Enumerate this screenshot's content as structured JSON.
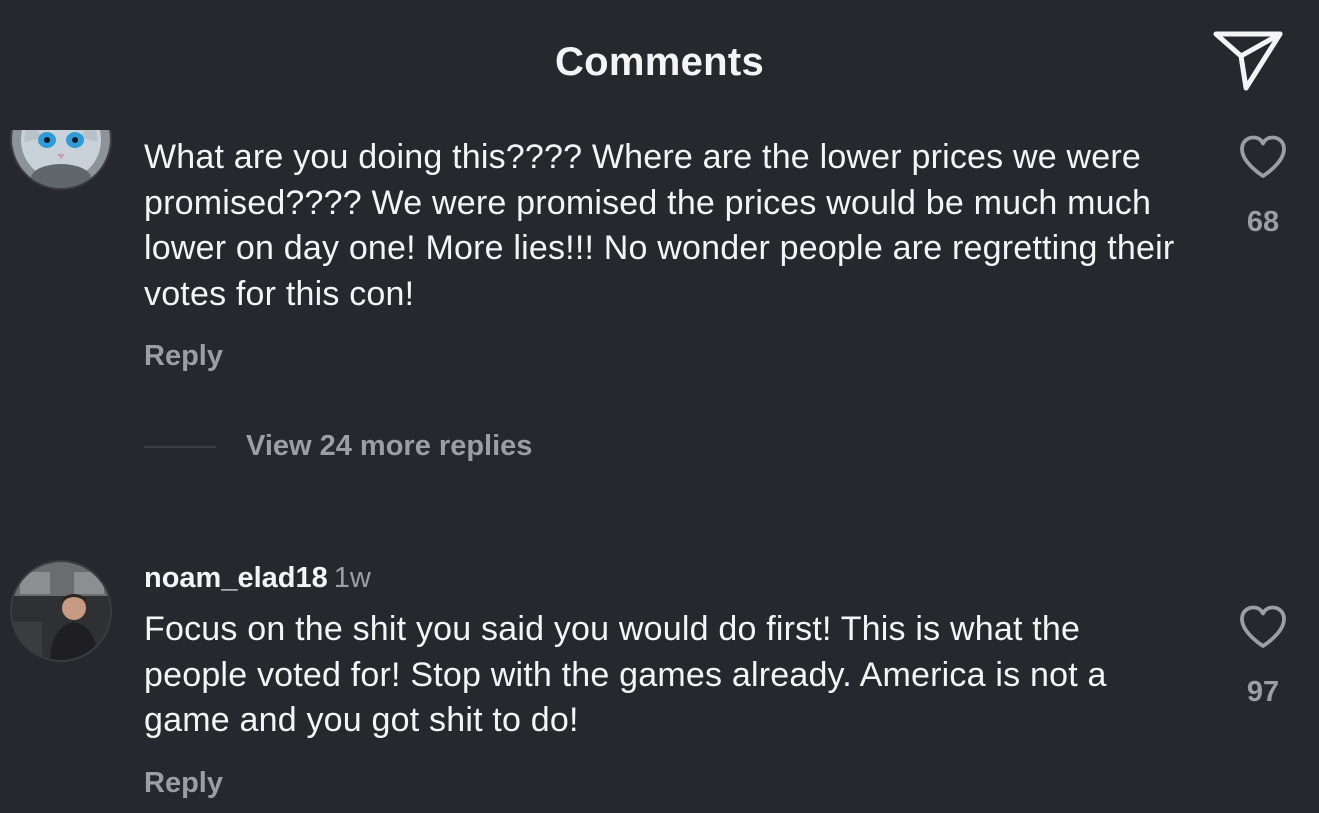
{
  "header": {
    "title": "Comments",
    "share_icon": "send-icon"
  },
  "comments": [
    {
      "username": "",
      "time": "",
      "text": "What are you doing this???? Where are the lower prices we were promised???? We were promised the prices would be much much lower on day one! More lies!!! No wonder people are regretting their votes for this con!",
      "reply_label": "Reply",
      "likes": "68",
      "like_icon": "heart-icon",
      "avatar_icon": "cat-avatar-icon"
    },
    {
      "username": "noam_elad18",
      "time": "1w",
      "text": "Focus on the shit you said you would do first! This is what the people voted for! Stop with the games already. America is not a game and you got shit to do!",
      "reply_label": "Reply",
      "likes": "97",
      "like_icon": "heart-icon",
      "avatar_icon": "person-avatar-icon"
    }
  ],
  "thread": {
    "view_replies_label": "View 24 more replies"
  },
  "colors": {
    "background": "#26282e",
    "text_primary": "#f4f4f5",
    "text_secondary": "#9b9ea4"
  }
}
